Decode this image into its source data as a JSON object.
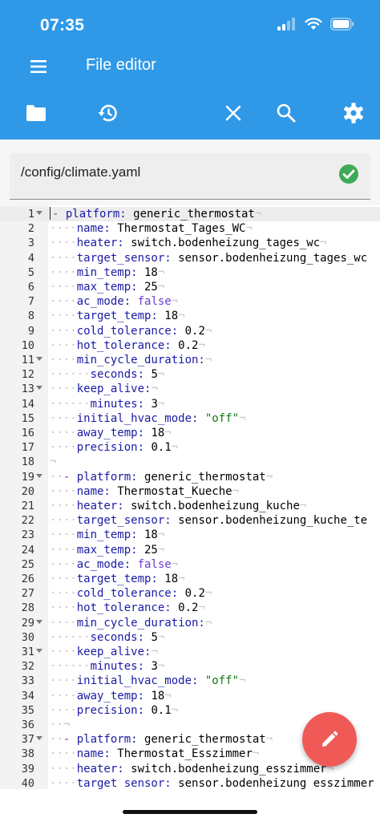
{
  "status": {
    "time": "07:35"
  },
  "app": {
    "title": "File editor"
  },
  "toolbar": {
    "icons": [
      "folder-icon",
      "history-icon",
      "close-icon",
      "search-icon",
      "gear-icon"
    ]
  },
  "file": {
    "path": "/config/climate.yaml",
    "status_icon": "check-circle-icon"
  },
  "colors": {
    "primary": "#2f99e8",
    "fab": "#f05a56",
    "valid": "#3faa57"
  },
  "editor": {
    "lines": [
      {
        "n": "1",
        "fold": true,
        "active": true,
        "g": "",
        "dash": true,
        "k": "platform:",
        "v": " generic_thermostat"
      },
      {
        "n": "2",
        "g": "····",
        "k": "name:",
        "v": " Thermostat_Tages_WC"
      },
      {
        "n": "3",
        "g": "····",
        "k": "heater:",
        "v": " switch.bodenheizung_tages_wc"
      },
      {
        "n": "4",
        "g": "····",
        "k": "target_sensor:",
        "v": " sensor.bodenheizung_tages_wc",
        "noeol": true
      },
      {
        "n": "5",
        "g": "····",
        "k": "min_temp:",
        "v": " 18"
      },
      {
        "n": "6",
        "g": "····",
        "k": "max_temp:",
        "v": " 25"
      },
      {
        "n": "7",
        "g": "····",
        "k": "ac_mode:",
        "kw": " false"
      },
      {
        "n": "8",
        "g": "····",
        "k": "target_temp:",
        "v": " 18"
      },
      {
        "n": "9",
        "g": "····",
        "k": "cold_tolerance:",
        "v": " 0.2"
      },
      {
        "n": "10",
        "g": "····",
        "k": "hot_tolerance:",
        "v": " 0.2"
      },
      {
        "n": "11",
        "fold": true,
        "g": "····",
        "k": "min_cycle_duration:",
        "v": ""
      },
      {
        "n": "12",
        "g": "······",
        "k": "seconds:",
        "v": " 5"
      },
      {
        "n": "13",
        "fold": true,
        "g": "····",
        "k": "keep_alive:",
        "v": ""
      },
      {
        "n": "14",
        "g": "······",
        "k": "minutes:",
        "v": " 3"
      },
      {
        "n": "15",
        "g": "····",
        "k": "initial_hvac_mode:",
        "s": " \"off\""
      },
      {
        "n": "16",
        "g": "····",
        "k": "away_temp:",
        "v": " 18"
      },
      {
        "n": "17",
        "g": "····",
        "k": "precision:",
        "v": " 0.1"
      },
      {
        "n": "18",
        "g": "",
        "k": "",
        "v": ""
      },
      {
        "n": "19",
        "fold": true,
        "g": "··",
        "dash": true,
        "k": "platform:",
        "v": " generic_thermostat"
      },
      {
        "n": "20",
        "g": "····",
        "k": "name:",
        "v": " Thermostat_Kueche"
      },
      {
        "n": "21",
        "g": "····",
        "k": "heater:",
        "v": " switch.bodenheizung_kuche"
      },
      {
        "n": "22",
        "g": "····",
        "k": "target_sensor:",
        "v": " sensor.bodenheizung_kuche_te",
        "noeol": true
      },
      {
        "n": "23",
        "g": "····",
        "k": "min_temp:",
        "v": " 18"
      },
      {
        "n": "24",
        "g": "····",
        "k": "max_temp:",
        "v": " 25"
      },
      {
        "n": "25",
        "g": "····",
        "k": "ac_mode:",
        "kw": " false"
      },
      {
        "n": "26",
        "g": "····",
        "k": "target_temp:",
        "v": " 18"
      },
      {
        "n": "27",
        "g": "····",
        "k": "cold_tolerance:",
        "v": " 0.2"
      },
      {
        "n": "28",
        "g": "····",
        "k": "hot_tolerance:",
        "v": " 0.2"
      },
      {
        "n": "29",
        "fold": true,
        "g": "····",
        "k": "min_cycle_duration:",
        "v": ""
      },
      {
        "n": "30",
        "g": "······",
        "k": "seconds:",
        "v": " 5"
      },
      {
        "n": "31",
        "fold": true,
        "g": "····",
        "k": "keep_alive:",
        "v": ""
      },
      {
        "n": "32",
        "g": "······",
        "k": "minutes:",
        "v": " 3"
      },
      {
        "n": "33",
        "g": "····",
        "k": "initial_hvac_mode:",
        "s": " \"off\""
      },
      {
        "n": "34",
        "g": "····",
        "k": "away_temp:",
        "v": " 18"
      },
      {
        "n": "35",
        "g": "····",
        "k": "precision:",
        "v": " 0.1"
      },
      {
        "n": "36",
        "g": "··",
        "k": "",
        "v": ""
      },
      {
        "n": "37",
        "fold": true,
        "g": "··",
        "dash": true,
        "k": "platform:",
        "v": " generic_thermostat"
      },
      {
        "n": "38",
        "g": "····",
        "k": "name:",
        "v": " Thermostat_Esszimmer"
      },
      {
        "n": "39",
        "g": "····",
        "k": "heater:",
        "v": " switch.bodenheizung_esszimmer"
      },
      {
        "n": "40",
        "g": "····",
        "k": "target_sensor:",
        "v": " sensor.bodenheizung_esszimmer",
        "noeol": true
      }
    ]
  }
}
